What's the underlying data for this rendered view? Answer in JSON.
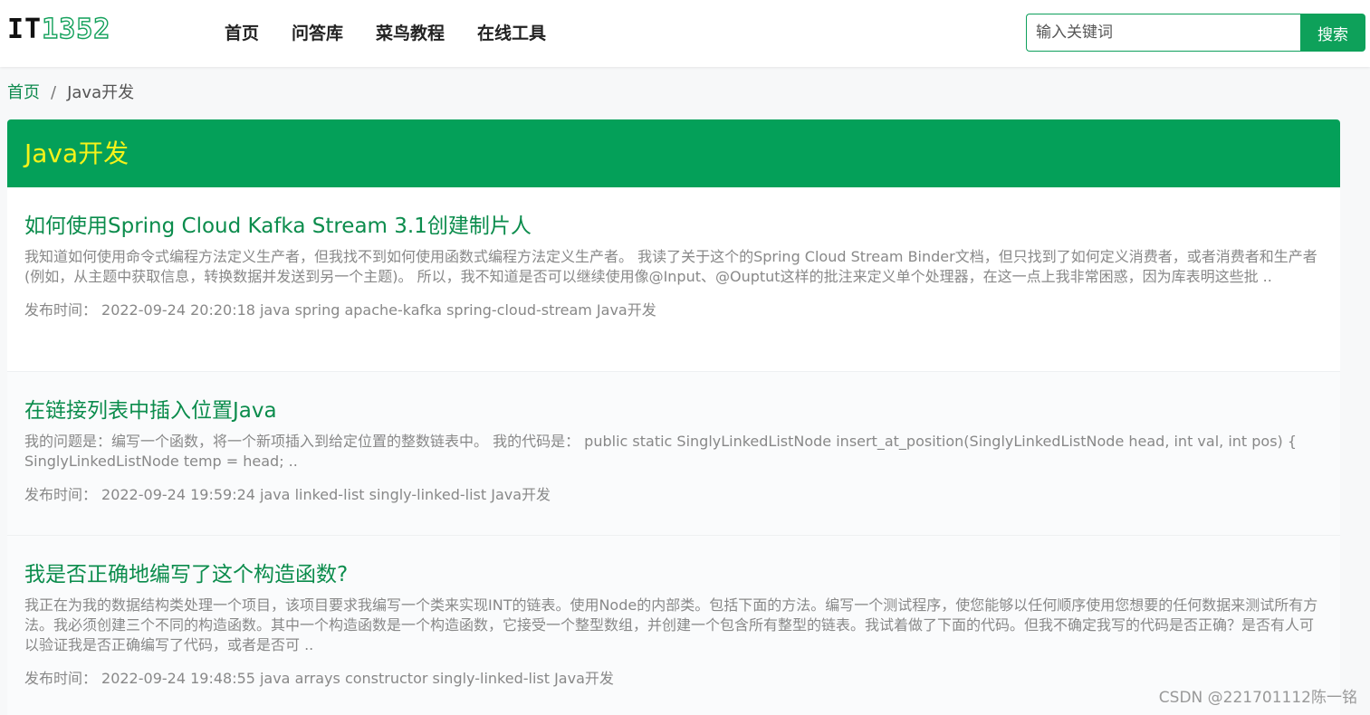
{
  "header": {
    "logo_prefix": "IT",
    "logo_number": "1352",
    "nav": [
      "首页",
      "问答库",
      "菜鸟教程",
      "在线工具"
    ],
    "search_placeholder": "输入关键词",
    "search_button": "搜索"
  },
  "breadcrumb": {
    "home": "首页",
    "separator": "/",
    "current": "Java开发"
  },
  "panel": {
    "title": "Java开发"
  },
  "articles": [
    {
      "title": "如何使用Spring Cloud Kafka Stream 3.1创建制片人",
      "excerpt": "我知道如何使用命令式编程方法定义生产者，但我找不到如何使用函数式编程方法定义生产者。 我读了关于这个的Spring Cloud Stream Binder文档，但只找到了如何定义消费者，或者消费者和生产者(例如，从主题中获取信息，转换数据并发送到另一个主题)。 所以，我不知道是否可以继续使用像@Input、@Ouptut这样的批注来定义单个处理器，在这一点上我非常困惑，因为库表明这些批 ..",
      "meta_label": "发布时间：",
      "date": "2022-09-24 20:20:18",
      "tags": "java spring apache-kafka spring-cloud-stream Java开发"
    },
    {
      "title": "在链接列表中插入位置Java",
      "excerpt": "我的问题是：编写一个函数，将一个新项插入到给定位置的整数链表中。 我的代码是： public static SinglyLinkedListNode insert_at_position(SinglyLinkedListNode head, int val, int pos) { SinglyLinkedListNode temp = head; ..",
      "meta_label": "发布时间：",
      "date": "2022-09-24 19:59:24",
      "tags": "java linked-list singly-linked-list Java开发"
    },
    {
      "title": "我是否正确地编写了这个构造函数?",
      "excerpt": "我正在为我的数据结构类处理一个项目，该项目要求我编写一个类来实现INT的链表。使用Node的内部类。包括下面的方法。编写一个测试程序，使您能够以任何顺序使用您想要的任何数据来测试所有方法。我必须创建三个不同的构造函数。其中一个构造函数是一个构造函数，它接受一个整型数组，并创建一个包含所有整型的链表。我试着做了下面的代码。但我不确定我写的代码是否正确？是否有人可以验证我是否正确编写了代码，或者是否可 ..",
      "meta_label": "发布时间：",
      "date": "2022-09-24 19:48:55",
      "tags": "java arrays constructor singly-linked-list Java开发"
    }
  ],
  "watermark": "CSDN @221701112陈一铭",
  "colors": {
    "brand_green": "#04a059",
    "title_yellow": "#f5f21a",
    "link_green": "#0b8c4c"
  }
}
